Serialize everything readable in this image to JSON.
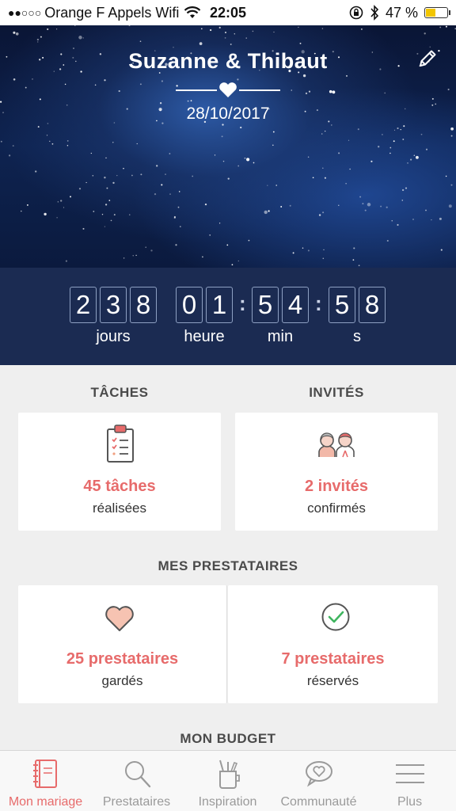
{
  "status_bar": {
    "carrier": "Orange F Appels Wifi",
    "time": "22:05",
    "battery": "47 %",
    "battery_level": 0.47
  },
  "header": {
    "names": "Suzanne & Thibaut",
    "date": "28/10/2017"
  },
  "countdown": {
    "days_digits": [
      "2",
      "3",
      "8"
    ],
    "hours_digits": [
      "0",
      "1"
    ],
    "minutes_digits": [
      "5",
      "4"
    ],
    "seconds_digits": [
      "5",
      "8"
    ],
    "labels": {
      "days": "jours",
      "hours": "heure",
      "minutes": "min",
      "seconds": "s"
    }
  },
  "tasks": {
    "title": "TÂCHES",
    "value": "45 tâches",
    "caption": "réalisées"
  },
  "guests": {
    "title": "INVITÉS",
    "value": "2 invités",
    "caption": "confirmés"
  },
  "vendors": {
    "title": "MES PRESTATAIRES",
    "saved": {
      "value": "25 prestataires",
      "caption": "gardés"
    },
    "booked": {
      "value": "7 prestataires",
      "caption": "réservés"
    }
  },
  "budget": {
    "title": "MON BUDGET"
  },
  "tab_bar": {
    "items": [
      {
        "label": "Mon mariage",
        "icon": "notebook-icon",
        "active": true
      },
      {
        "label": "Prestataires",
        "icon": "search-icon",
        "active": false
      },
      {
        "label": "Inspiration",
        "icon": "pencil-cup-icon",
        "active": false
      },
      {
        "label": "Communauté",
        "icon": "chat-heart-icon",
        "active": false
      },
      {
        "label": "Plus",
        "icon": "menu-icon",
        "active": false
      }
    ]
  },
  "colors": {
    "accent": "#e76b6b",
    "countdown_bg": "#1b2b52",
    "header_bg": "#0e2350"
  }
}
